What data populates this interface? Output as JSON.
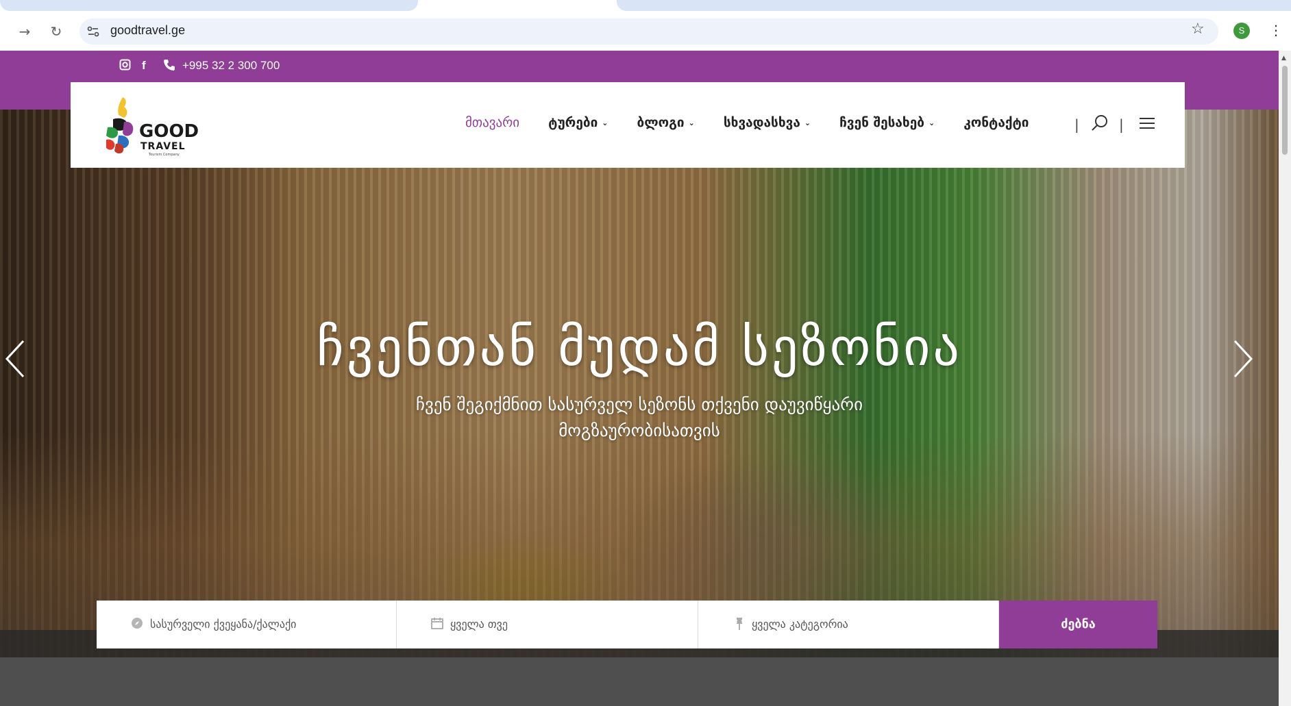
{
  "browser": {
    "url": "goodtravel.ge",
    "profile_initial": "S"
  },
  "topbar": {
    "phone": "+995 32 2 300 700",
    "icons": [
      "instagram-icon",
      "facebook-icon",
      "phone-icon"
    ]
  },
  "logo": {
    "text": "GOOD TRAVEL",
    "tagline": "Tourism Company"
  },
  "nav": {
    "items": [
      {
        "label": "მთავარი",
        "active": true,
        "dropdown": false
      },
      {
        "label": "ტურები",
        "active": false,
        "dropdown": true
      },
      {
        "label": "ბლოგი",
        "active": false,
        "dropdown": true
      },
      {
        "label": "სხვადასხვა",
        "active": false,
        "dropdown": true
      },
      {
        "label": "ჩვენ შესახებ",
        "active": false,
        "dropdown": true
      },
      {
        "label": "კონტაქტი",
        "active": false,
        "dropdown": false
      }
    ]
  },
  "hero": {
    "title": "ჩვენთან მუდამ სეზონია",
    "subtitle": "ჩვენ შეგიქმნით სასურველ სეზონს თქვენი დაუვიწყარი მოგზაურობისათვის"
  },
  "search": {
    "destination_placeholder": "სასურველი ქვეყანა/ქალაქი",
    "month_placeholder": "ყველა თვე",
    "category_placeholder": "ყველა კატეგორია",
    "button_label": "ძებნა"
  },
  "colors": {
    "brand_purple": "#8f3d96"
  }
}
